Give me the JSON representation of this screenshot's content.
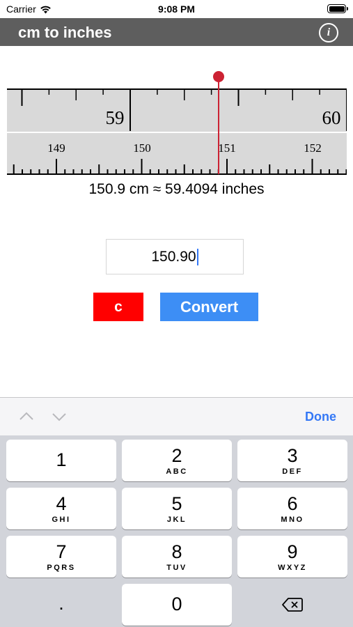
{
  "status_bar": {
    "carrier": "Carrier",
    "time": "9:08 PM",
    "battery_level": 1.0
  },
  "nav": {
    "title": "cm to inches",
    "info_label": "i"
  },
  "ruler": {
    "inch_labels": [
      "59",
      "60"
    ],
    "cm_labels": [
      "149",
      "150",
      "151",
      "152"
    ],
    "marker_value_cm": 150.9,
    "background_color": "#d9d9d9",
    "marker_color": "#cc2233"
  },
  "result": {
    "text": "150.9 cm ≈ 59.4094 inches"
  },
  "input": {
    "value": "150.90"
  },
  "buttons": {
    "clear_label": "c",
    "clear_color": "#ff0000",
    "convert_label": "Convert",
    "convert_color": "#3d8ef5"
  },
  "keyboard": {
    "done_label": "Done",
    "keys": [
      {
        "num": "1",
        "letters": ""
      },
      {
        "num": "2",
        "letters": "ABC"
      },
      {
        "num": "3",
        "letters": "DEF"
      },
      {
        "num": "4",
        "letters": "GHI"
      },
      {
        "num": "5",
        "letters": "JKL"
      },
      {
        "num": "6",
        "letters": "MNO"
      },
      {
        "num": "7",
        "letters": "PQRS"
      },
      {
        "num": "8",
        "letters": "TUV"
      },
      {
        "num": "9",
        "letters": "WXYZ"
      },
      {
        "num": "0",
        "letters": ""
      }
    ],
    "dot_label": ".",
    "backspace_icon": "delete-backward-icon",
    "prev_icon": "chevron-up-icon",
    "next_icon": "chevron-down-icon"
  }
}
